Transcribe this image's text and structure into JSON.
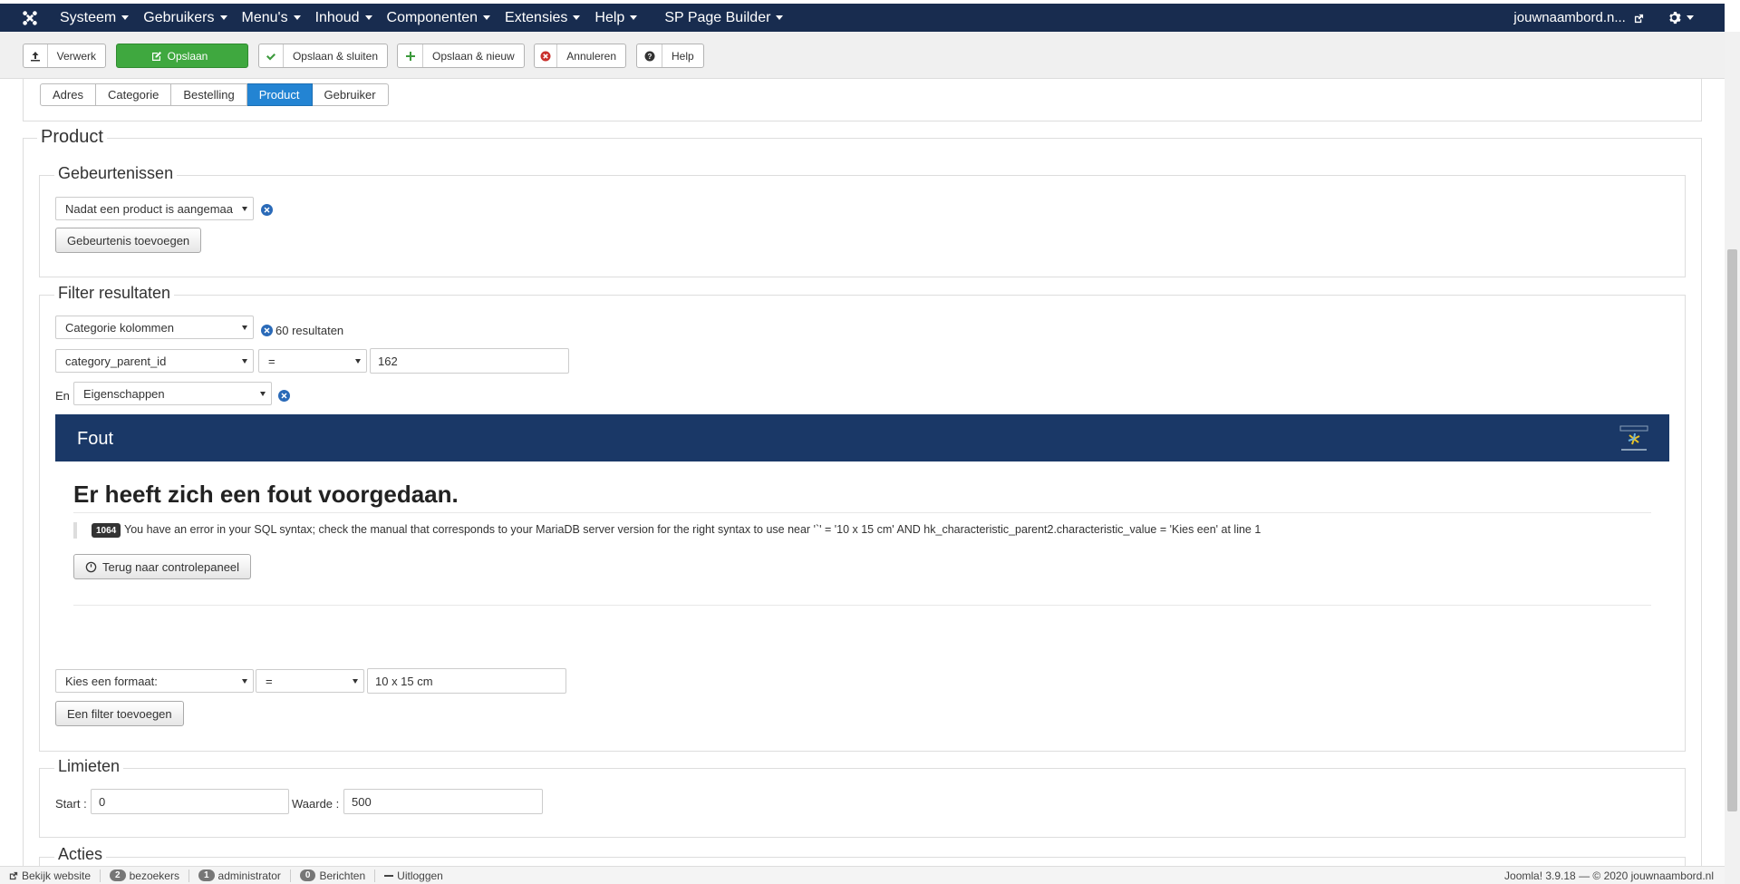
{
  "navbar": {
    "menus": [
      "Systeem",
      "Gebruikers",
      "Menu's",
      "Inhoud",
      "Componenten",
      "Extensies",
      "Help",
      "SP Page Builder"
    ],
    "user": "jouwnaambord.n..."
  },
  "toolbar": {
    "process": "Verwerk",
    "save": "Opslaan",
    "save_close": "Opslaan & sluiten",
    "save_new": "Opslaan & nieuw",
    "cancel": "Annuleren",
    "help": "Help"
  },
  "subtabs": [
    "Adres",
    "Categorie",
    "Bestelling",
    "Product",
    "Gebruiker"
  ],
  "product": {
    "legend": "Product",
    "events": {
      "legend": "Gebeurtenissen",
      "event_select": "Nadat een product is aangemaa",
      "add_button": "Gebeurtenis toevoegen"
    },
    "filter": {
      "legend": "Filter resultaten",
      "type_select": "Categorie kolommen",
      "result_count": "60 resultaten",
      "field_select": "category_parent_id",
      "operator": "=",
      "value": "162",
      "and_label": "En",
      "and_select": "Eigenschappen",
      "second_field": "Kies een formaat:",
      "second_operator": "=",
      "second_value": "10 x 15 cm",
      "add_filter": "Een filter toevoegen"
    },
    "error": {
      "banner_title": "Fout",
      "heading": "Er heeft zich een fout voorgedaan.",
      "code": "1064",
      "message": "You have an error in your SQL syntax; check the manual that corresponds to your MariaDB server version for the right syntax to use near '`' = '10 x 15 cm' AND hk_characteristic_parent2.characteristic_value = 'Kies een' at line 1",
      "back_button": "Terug naar controlepaneel"
    },
    "limits": {
      "legend": "Limieten",
      "start_label": "Start :",
      "start_value": "0",
      "value_label": "Waarde :",
      "value_value": "500"
    },
    "actions": {
      "legend": "Acties"
    }
  },
  "statusbar": {
    "view_site": "Bekijk website",
    "visitors_count": "2",
    "visitors_label": "bezoekers",
    "admin_count": "1",
    "admin_label": "administrator",
    "messages_count": "0",
    "messages_label": "Berichten",
    "logout": "Uitloggen",
    "version": "Joomla! 3.9.18  —  © 2020 jouwnaambord.nl"
  },
  "colors": {
    "navbar": "#182c4f",
    "save_green": "#3fa83f",
    "active_tab": "#2384d3",
    "error_banner": "#1a3867"
  }
}
